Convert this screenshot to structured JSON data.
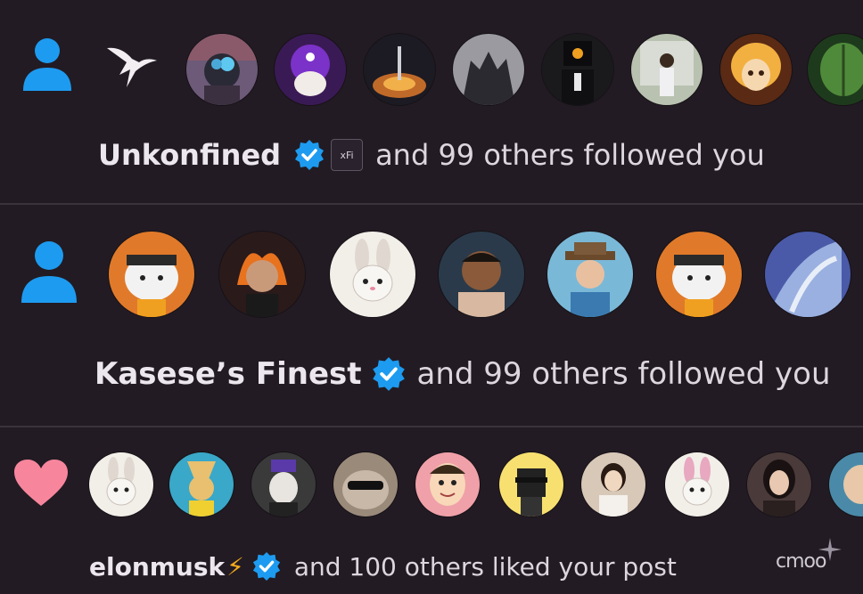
{
  "notifications": [
    {
      "type": "follow",
      "type_icon": "person-icon",
      "name": "Unkonfined",
      "extra_badge": "xFi",
      "rest": "and 99 others followed you"
    },
    {
      "type": "follow",
      "type_icon": "person-icon",
      "name": "Kasese’s Finest",
      "rest": "and 99 others followed you"
    },
    {
      "type": "like",
      "type_icon": "heart-icon",
      "name": "elonmusk",
      "name_emoji": "⚡",
      "rest": "and 100 others liked your post"
    }
  ],
  "watermark": "cmoo",
  "colors": {
    "background": "#221b23",
    "verified_blue": "#1d9bf0",
    "person_icon": "#1d9bf0",
    "heart": "#f7869d",
    "divider": "#3a333c"
  }
}
